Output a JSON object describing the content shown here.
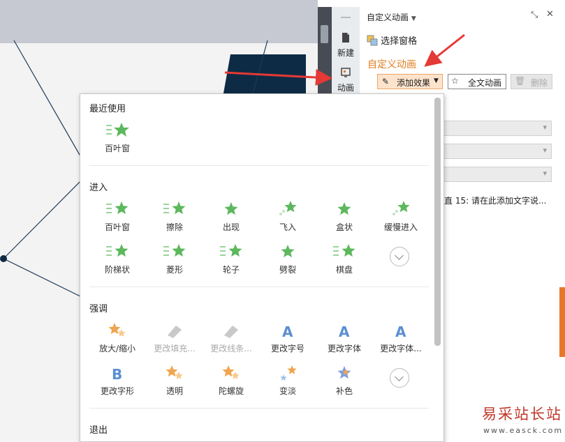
{
  "side_tabs": {
    "new_label": "新建",
    "anim_label": "动画"
  },
  "task_pane": {
    "title": "自定义动画",
    "select_pane_label": "选择窗格",
    "section_label": "自定义动画",
    "add_effect_label": "添加效果",
    "full_anim_label": "全文动画",
    "delete_label": "删除",
    "anim_list_item": "直 15: 请在此添加文字说..."
  },
  "dropdown": {
    "recent": {
      "title": "最近使用",
      "items": [
        "百叶窗"
      ]
    },
    "enter": {
      "title": "进入",
      "items": [
        "百叶窗",
        "擦除",
        "出现",
        "飞入",
        "盒状",
        "缓慢进入",
        "阶梯状",
        "菱形",
        "轮子",
        "劈裂",
        "棋盘"
      ]
    },
    "emphasis": {
      "title": "强调",
      "items": [
        "放大/缩小",
        "更改填充...",
        "更改线条...",
        "更改字号",
        "更改字体",
        "更改字体...",
        "更改字形",
        "透明",
        "陀螺旋",
        "变淡",
        "补色"
      ]
    },
    "exit": {
      "title": "退出"
    }
  },
  "watermark": {
    "brand": "易采站长站",
    "url": "www.easck.com"
  },
  "colors": {
    "accent": "#e07d1c",
    "star_green": "#5cb85c",
    "arrow_red": "#e53935"
  }
}
